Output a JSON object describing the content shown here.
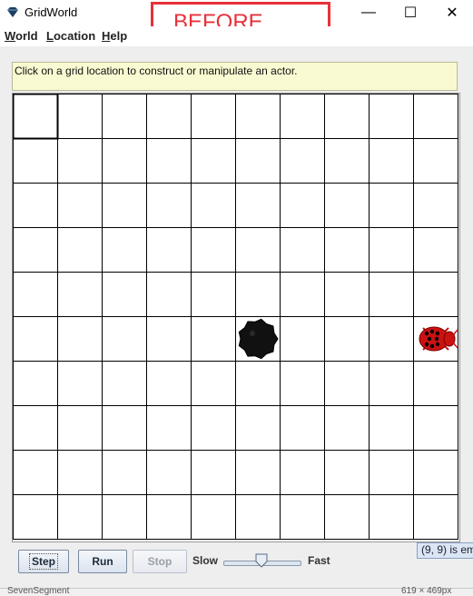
{
  "window": {
    "title": "GridWorld",
    "minimize_glyph": "—",
    "maximize_glyph": "☐",
    "close_glyph": "✕"
  },
  "annotation": {
    "label": "BEFORE",
    "color": "#e8313a"
  },
  "menu": {
    "items": [
      {
        "mnemonic": "W",
        "rest": "orld"
      },
      {
        "mnemonic": "L",
        "rest": "ocation"
      },
      {
        "mnemonic": "H",
        "rest": "elp"
      }
    ]
  },
  "message": {
    "text": "Click on a grid location to construct or manipulate an actor.",
    "background": "#fafad2"
  },
  "grid": {
    "rows": 10,
    "cols": 10,
    "selected": {
      "row": 0,
      "col": 0
    },
    "actors": [
      {
        "type": "rock",
        "icon": "rock-icon",
        "row": 5,
        "col": 5,
        "color": "#111111"
      },
      {
        "type": "bug",
        "icon": "ladybug-icon",
        "row": 5,
        "col": 9,
        "color": "#cc1111"
      }
    ]
  },
  "controls": {
    "step_label": "Step",
    "run_label": "Run",
    "stop_label": "Stop",
    "stop_enabled": false,
    "slow_label": "Slow",
    "fast_label": "Fast",
    "speed_fraction": 0.5
  },
  "status": {
    "text": "(9, 9) is em"
  },
  "taskbar": {
    "left_text": "SevenSegment",
    "right_text": "619 × 469px"
  }
}
